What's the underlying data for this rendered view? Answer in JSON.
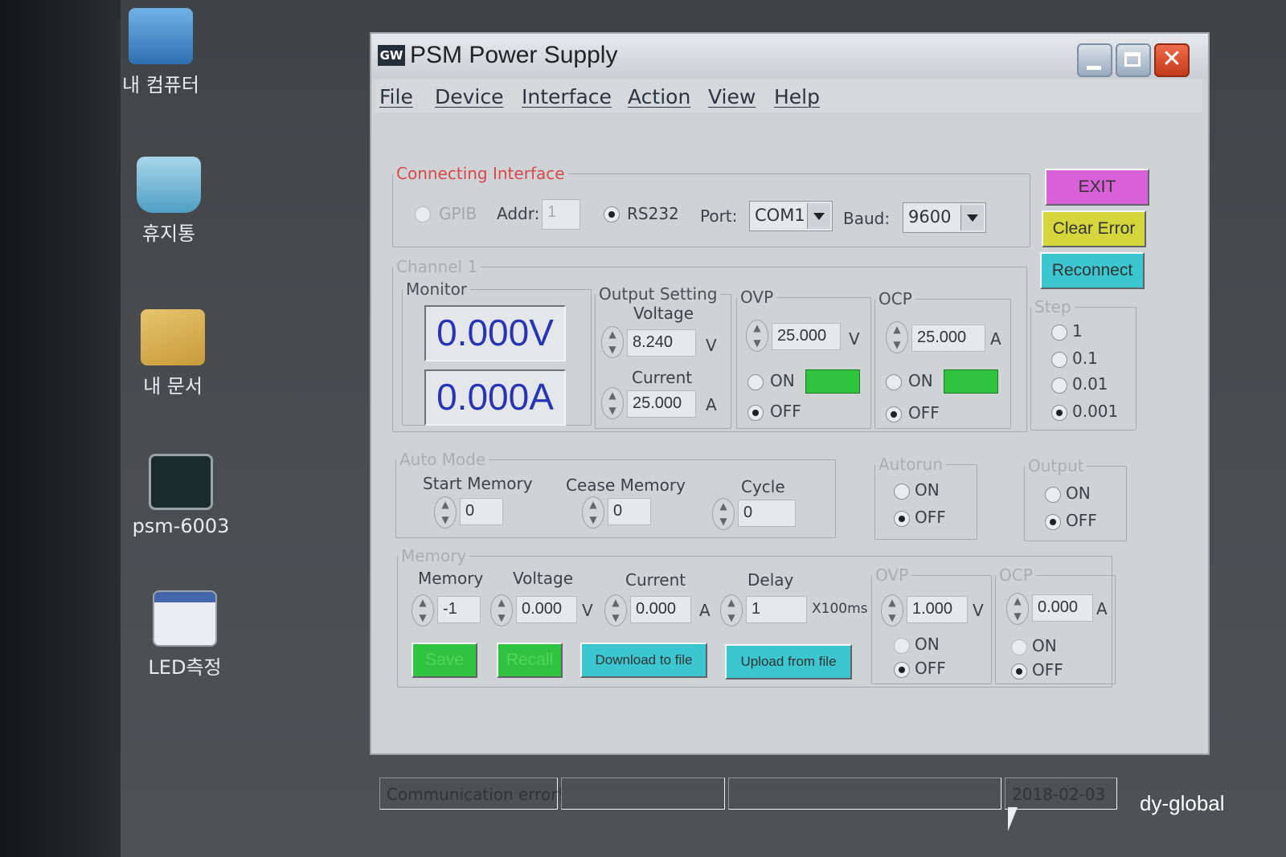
{
  "desktop": {
    "icons": [
      {
        "label": "내 컴퓨터",
        "icon": "computer-icon"
      },
      {
        "label": "휴지통",
        "icon": "recycle-bin-icon"
      },
      {
        "label": "내 문서",
        "icon": "my-documents-icon"
      },
      {
        "label": "psm-6003",
        "icon": "psm-shortcut-icon"
      },
      {
        "label": "LED측정",
        "icon": "led-shortcut-icon"
      }
    ],
    "watermark": "dy-global"
  },
  "window": {
    "logo": "GW",
    "title": "PSM Power Supply",
    "controls": {
      "minimize": "minimize-icon",
      "maximize": "maximize-icon",
      "close": "✕"
    }
  },
  "menu": [
    "File",
    "Device",
    "Interface",
    "Action",
    "View",
    "Help"
  ],
  "interface": {
    "legend": "Connecting Interface",
    "gpib": "GPIB",
    "addr_label": "Addr:",
    "addr_value": "1",
    "rs232": "RS232",
    "rs232_selected": true,
    "port_label": "Port:",
    "port_value": "COM1",
    "baud_label": "Baud:",
    "baud_value": "9600"
  },
  "buttons": {
    "exit": "EXIT",
    "clear_error": "Clear Error",
    "reconnect": "Reconnect",
    "exit_color": "#d860d8",
    "clear_color": "#d4d63c",
    "reconnect_color": "#3cc6cf"
  },
  "channel": {
    "legend": "Channel 1",
    "monitor_legend": "Monitor",
    "monitor_voltage": "0.000V",
    "monitor_current": "0.000A",
    "output_legend": "Output Setting",
    "voltage_label": "Voltage",
    "voltage_value": "8.240",
    "voltage_unit": "V",
    "current_label": "Current",
    "current_value": "25.000",
    "current_unit": "A",
    "ovp_legend": "OVP",
    "ovp_value": "25.000",
    "ovp_unit": "V",
    "ocp_legend": "OCP",
    "ocp_value": "25.000",
    "ocp_unit": "A",
    "on": "ON",
    "off": "OFF"
  },
  "step": {
    "legend": "Step",
    "options": [
      "1",
      "0.1",
      "0.01",
      "0.001"
    ],
    "selected": "0.001"
  },
  "auto_mode": {
    "legend": "Auto Mode",
    "start_label": "Start Memory",
    "start_value": "0",
    "cease_label": "Cease Memory",
    "cease_value": "0",
    "cycle_label": "Cycle",
    "cycle_value": "0"
  },
  "autorun": {
    "legend": "Autorun",
    "on": "ON",
    "off": "OFF"
  },
  "output": {
    "legend": "Output",
    "on": "ON",
    "off": "OFF"
  },
  "memory": {
    "legend": "Memory",
    "memory_label": "Memory",
    "memory_value": "-1",
    "voltage_label": "Voltage",
    "voltage_value": "0.000",
    "voltage_unit": "V",
    "current_label": "Current",
    "current_value": "0.000",
    "current_unit": "A",
    "delay_label": "Delay",
    "delay_value": "1",
    "delay_unit": "X100ms",
    "ovp_legend": "OVP",
    "ovp_value": "1.000",
    "ovp_unit": "V",
    "ocp_legend": "OCP",
    "ocp_value": "0.000",
    "ocp_unit": "A",
    "on": "ON",
    "off": "OFF",
    "save": "Save",
    "recall": "Recall",
    "download": "Download to file",
    "upload": "Upload from file"
  },
  "status": {
    "message": "Communication error!",
    "date": "2018-02-03"
  }
}
